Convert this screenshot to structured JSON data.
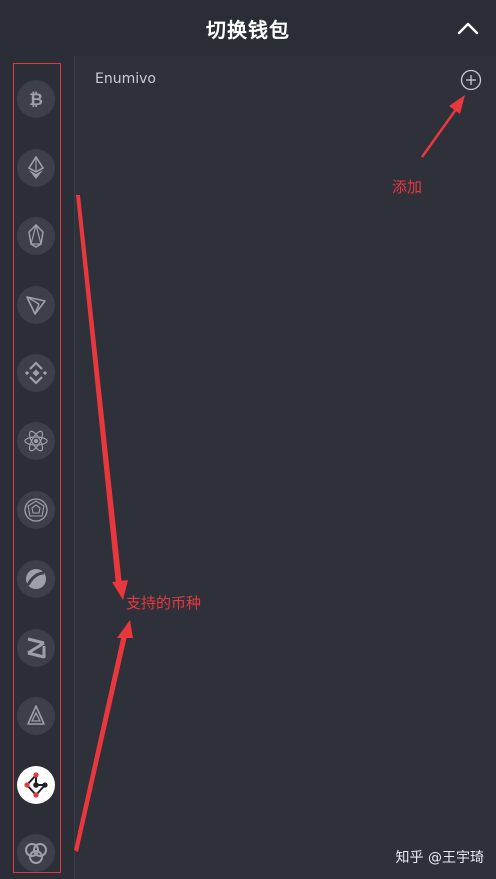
{
  "header": {
    "title": "切换钱包",
    "collapse_icon": "chevron-up-icon"
  },
  "sidebar": {
    "coins": [
      {
        "icon": "bitcoin-icon"
      },
      {
        "icon": "ethereum-icon"
      },
      {
        "icon": "eos-icon"
      },
      {
        "icon": "tron-icon"
      },
      {
        "icon": "binance-icon"
      },
      {
        "icon": "cosmos-atom-icon"
      },
      {
        "icon": "iris-icon"
      },
      {
        "icon": "ontology-icon"
      },
      {
        "icon": "zilliqa-icon"
      },
      {
        "icon": "aeternity-icon"
      },
      {
        "icon": "network-nodes-icon",
        "active": true
      },
      {
        "icon": "circles-icon"
      }
    ]
  },
  "main": {
    "wallet_name": "Enumivo",
    "add_icon": "plus-circle-icon"
  },
  "annotations": {
    "add_label": "添加",
    "coins_label": "支持的币种",
    "color": "#e8383d"
  },
  "watermark": "知乎 @王宇琦"
}
